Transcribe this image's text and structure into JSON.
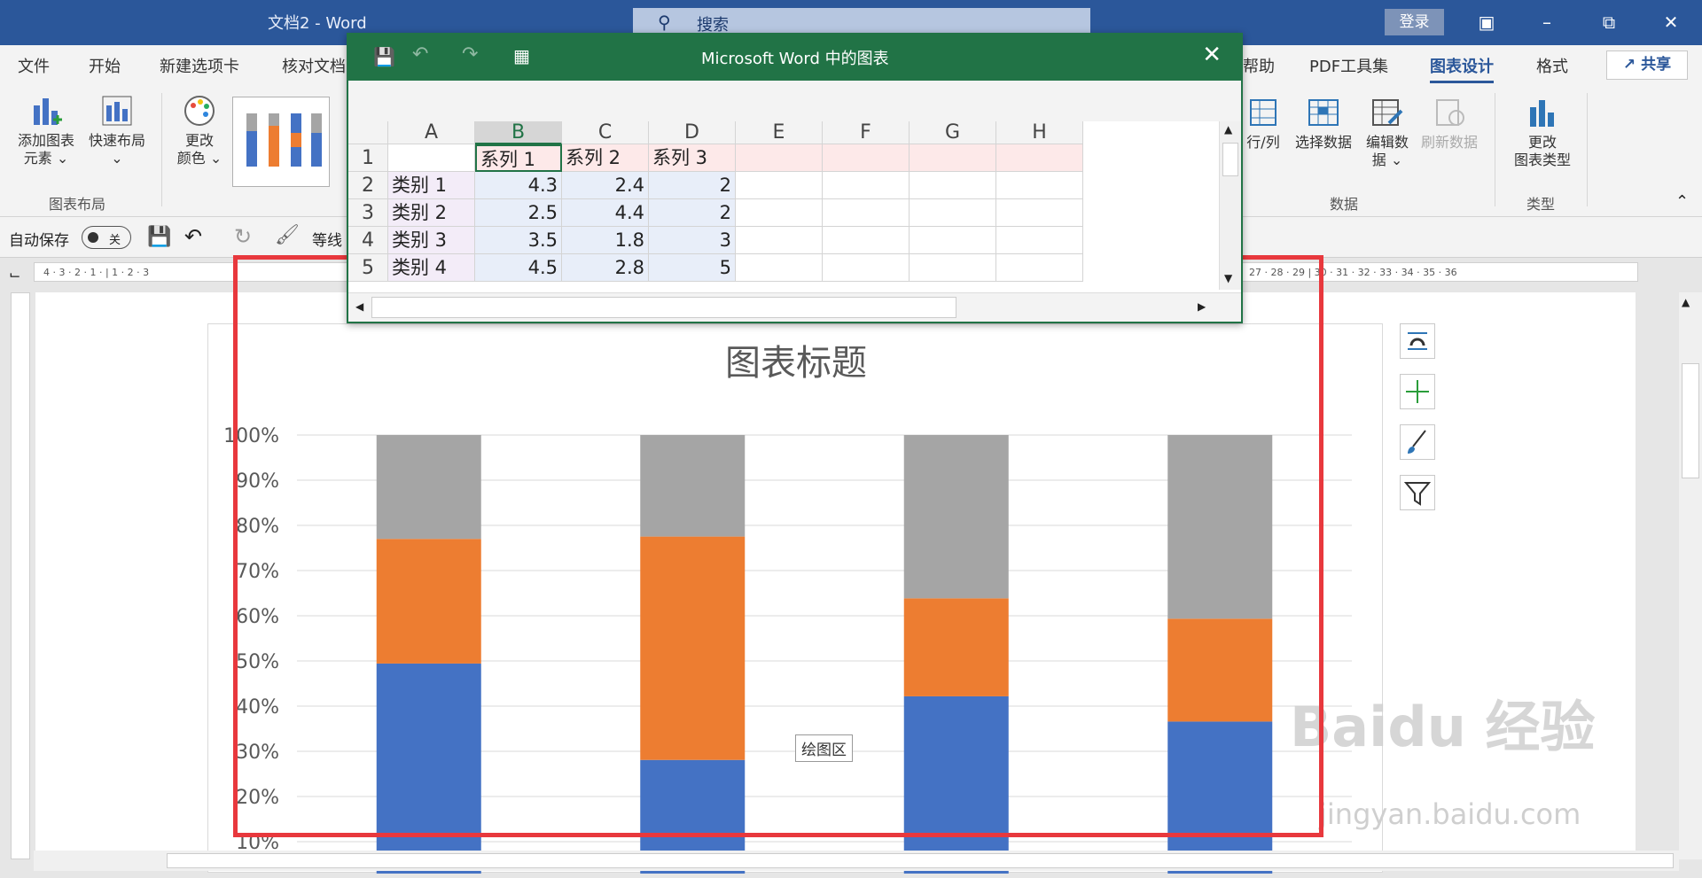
{
  "window": {
    "doc_title": "文档2  -  Word",
    "search_placeholder": "搜索",
    "login": "登录"
  },
  "tabs": [
    "文件",
    "开始",
    "新建选项卡",
    "核对文档",
    "帮助",
    "PDF工具集",
    "图表设计",
    "格式"
  ],
  "active_tab": "图表设计",
  "share": "共享",
  "ribbon": {
    "add_element": "添加图表\n元素",
    "quick_layout": "快速布局",
    "change_color": "更改\n颜色",
    "group_layout": "图表布局",
    "switch_row_col": "行/列",
    "select_data": "选择数据",
    "edit_data": "编辑数\n据",
    "refresh_data": "刷新数据",
    "change_type": "更改\n图表类型",
    "group_data": "数据",
    "group_type": "类型"
  },
  "qat": {
    "autosave": "自动保存",
    "toggle": "关",
    "font": "等线"
  },
  "ruler_left": [
    "4",
    "3",
    "2",
    "1",
    "",
    "1",
    "2",
    "3"
  ],
  "ruler_right": [
    "27",
    "28",
    "29",
    "30",
    "31",
    "32",
    "33",
    "34",
    "35",
    "36"
  ],
  "excel": {
    "title": "Microsoft Word 中的图表",
    "columns": [
      "A",
      "B",
      "C",
      "D",
      "E",
      "F",
      "G",
      "H"
    ],
    "rows": [
      "1",
      "2",
      "3",
      "4",
      "5"
    ],
    "header": [
      "",
      "系列 1",
      "系列 2",
      "系列 3"
    ],
    "data": [
      [
        "类别 1",
        "4.3",
        "2.4",
        "2"
      ],
      [
        "类别 2",
        "2.5",
        "4.4",
        "2"
      ],
      [
        "类别 3",
        "3.5",
        "1.8",
        "3"
      ],
      [
        "类别 4",
        "4.5",
        "2.8",
        "5"
      ]
    ]
  },
  "tooltip": "绘图区",
  "watermark": {
    "main": "Baidu 经验",
    "sub": "jingyan.baidu.com"
  },
  "colors": {
    "series1": "#4472c4",
    "series2": "#ed7d31",
    "series3": "#a5a5a5",
    "highlight": "#e8383d",
    "word_blue": "#2b579a",
    "excel_green": "#217346"
  },
  "chart_data": {
    "type": "bar",
    "stacked": "percent",
    "title": "图表标题",
    "categories": [
      "类别 1",
      "类别 2",
      "类别 3",
      "类别 4"
    ],
    "series": [
      {
        "name": "系列 1",
        "values": [
          4.3,
          2.5,
          3.5,
          4.5
        ]
      },
      {
        "name": "系列 2",
        "values": [
          2.4,
          4.4,
          1.8,
          2.8
        ]
      },
      {
        "name": "系列 3",
        "values": [
          2,
          2,
          3,
          5
        ]
      }
    ],
    "yticks": [
      "100%",
      "90%",
      "80%",
      "70%",
      "60%",
      "50%",
      "40%",
      "30%",
      "20%",
      "10%"
    ],
    "ylim": [
      0,
      100
    ]
  }
}
